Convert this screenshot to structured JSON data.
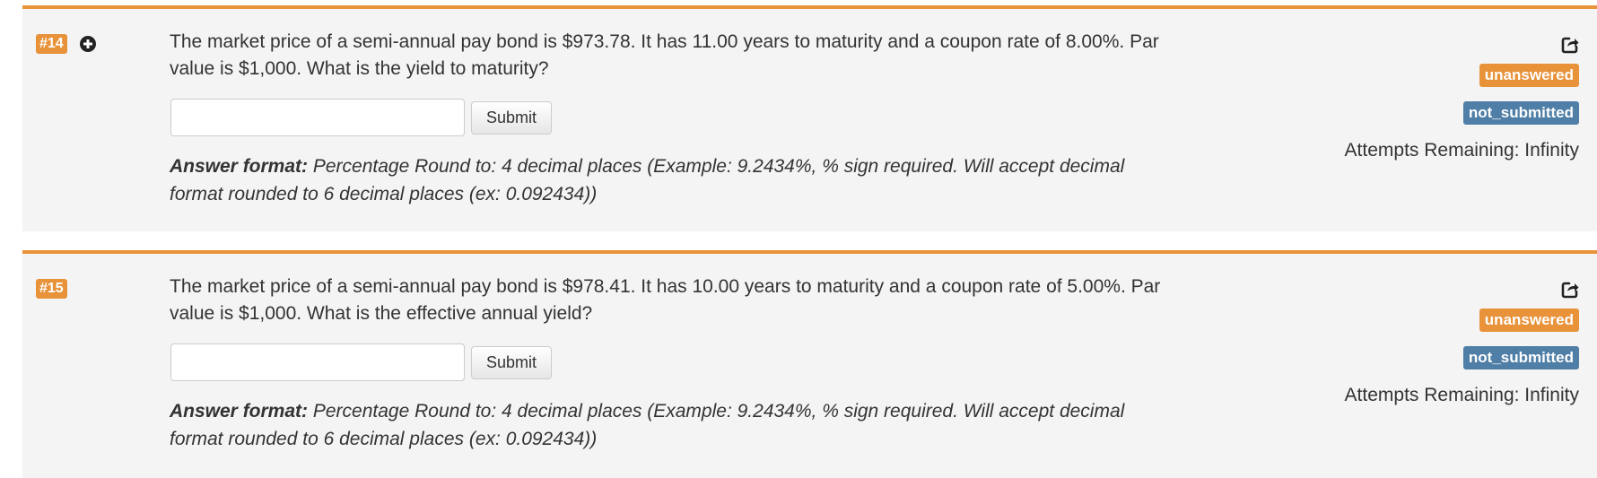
{
  "questions": [
    {
      "number": "#14",
      "text": "The market price of a semi-annual pay bond is $973.78. It has 11.00 years to maturity and a coupon rate of 8.00%. Par value is $1,000. What is the yield to maturity?",
      "input_value": "",
      "submit_label": "Submit",
      "answer_format_label": "Answer format:",
      "answer_format_text": " Percentage Round to: 4 decimal places (Example: 9.2434%, % sign required. Will accept decimal format rounded to 6 decimal places (ex: 0.092434))",
      "status_answer": "unanswered",
      "status_submission": "not_submitted",
      "attempts": "Attempts Remaining: Infinity",
      "icons": [
        "plus-circle-icon",
        "share-icon"
      ]
    },
    {
      "number": "#15",
      "text": "The market price of a semi-annual pay bond is $978.41. It has 10.00 years to maturity and a coupon rate of 5.00%. Par value is $1,000. What is the effective annual yield?",
      "input_value": "",
      "submit_label": "Submit",
      "answer_format_label": "Answer format:",
      "answer_format_text": " Percentage Round to: 4 decimal places (Example: 9.2434%, % sign required. Will accept decimal format rounded to 6 decimal places (ex: 0.092434))",
      "status_answer": "unanswered",
      "status_submission": "not_submitted",
      "attempts": "Attempts Remaining: Infinity",
      "icons": [
        "share-icon"
      ]
    }
  ],
  "colors": {
    "accent_orange": "#e8923a",
    "badge_blue": "#4f7ea6",
    "panel_bg": "#f4f4f4"
  }
}
